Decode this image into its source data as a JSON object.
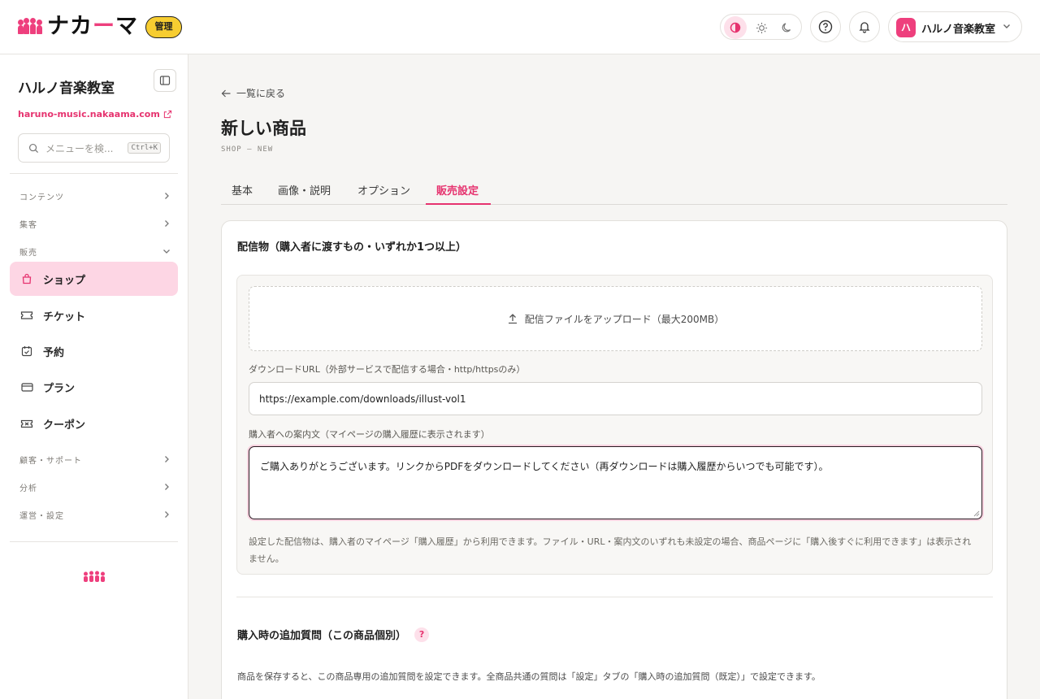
{
  "header": {
    "logo_text_1": "ナカ",
    "logo_text_2": "ー",
    "logo_text_3": "マ",
    "admin_badge": "管理",
    "user_avatar": "ハ",
    "user_name": "ハルノ音楽教室"
  },
  "sidebar": {
    "site_name": "ハルノ音楽教室",
    "site_url": "haruno-music.nakaama.com",
    "search_placeholder": "メニューを検...",
    "search_shortcut": "Ctrl+K",
    "groups": {
      "contents": "コンテンツ",
      "marketing": "集客",
      "sales": "販売",
      "customers": "顧客・サポート",
      "analytics": "分析",
      "settings": "運営・設定"
    },
    "items": {
      "shop": "ショップ",
      "ticket": "チケット",
      "reservation": "予約",
      "plan": "プラン",
      "coupon": "クーポン"
    }
  },
  "main": {
    "back_label": "一覧に戻る",
    "title": "新しい商品",
    "subtitle": "SHOP — NEW",
    "tabs": [
      "基本",
      "画像・説明",
      "オプション",
      "販売設定"
    ],
    "active_tab": "販売設定"
  },
  "delivery": {
    "section_title": "配信物（購入者に渡すもの・いずれか1つ以上）",
    "upload_label": "配信ファイルをアップロード（最大200MB）",
    "url_label": "ダウンロードURL（外部サービスで配信する場合・http/httpsのみ）",
    "url_value": "https://example.com/downloads/illust-vol1",
    "message_label": "購入者への案内文（マイページの購入履歴に表示されます）",
    "message_value": "ご購入ありがとうございます。リンクからPDFをダウンロードしてください（再ダウンロードは購入履歴からいつでも可能です）。",
    "help_text": "設定した配信物は、購入者のマイページ「購入履歴」から利用できます。ファイル・URL・案内文のいずれも未設定の場合、商品ページに「購入後すぐに利用できます」は表示されません。"
  },
  "questions": {
    "section_title": "購入時の追加質問（この商品個別）",
    "help_badge": "?",
    "text": "商品を保存すると、この商品専用の追加質問を設定できます。全商品共通の質問は「設定」タブの「購入時の追加質問（既定）」で設定できます。"
  },
  "colors": {
    "accent": "#ee3f7d",
    "accent_dark": "#e6336f",
    "active_bg": "#fdd6e4",
    "badge_yellow": "#f7cd31"
  }
}
